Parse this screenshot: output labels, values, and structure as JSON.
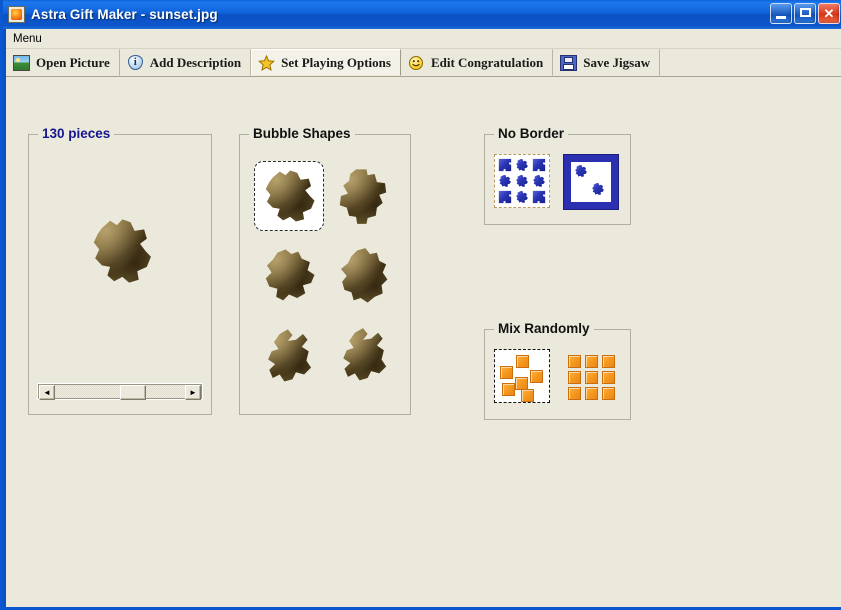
{
  "window": {
    "title_app": "Astra Gift Maker",
    "title_sep": " - ",
    "title_file": "sunset.jpg",
    "app_icon": "astra-app-icon",
    "controls": {
      "minimize": "minimize-button",
      "maximize": "maximize-button",
      "close": "close-button"
    },
    "colors": {
      "titlebar": "#0a51c4",
      "client_bg": "#ebe9dc",
      "legend_blue": "#16178c",
      "accent_orange": "#f79a1e",
      "accent_blue": "#2a30b0"
    }
  },
  "menubar": {
    "items": [
      {
        "label": "Menu"
      }
    ]
  },
  "toolbar": {
    "buttons": [
      {
        "label": "Open Picture",
        "icon": "picture-icon",
        "active": false
      },
      {
        "label": "Add Description",
        "icon": "info-icon",
        "active": false
      },
      {
        "label": "Set Playing Options",
        "icon": "star-icon",
        "active": true
      },
      {
        "label": "Edit Congratulation",
        "icon": "smiley-icon",
        "active": false
      },
      {
        "label": "Save Jigsaw",
        "icon": "floppy-icon",
        "active": false
      }
    ]
  },
  "panels": {
    "pieces": {
      "legend": "130 pieces",
      "piece_count": 130,
      "scrollbar": {
        "left_arrow": "◄",
        "right_arrow": "►",
        "thumb_position_pct": 50
      }
    },
    "shapes": {
      "legend": "Bubble Shapes",
      "items": [
        {
          "name": "shape-1",
          "selected": true
        },
        {
          "name": "shape-2",
          "selected": false
        },
        {
          "name": "shape-3",
          "selected": false
        },
        {
          "name": "shape-4",
          "selected": false
        },
        {
          "name": "shape-5",
          "selected": false
        },
        {
          "name": "shape-6",
          "selected": false
        }
      ]
    },
    "border": {
      "legend": "No Border",
      "options": [
        {
          "name": "no-border",
          "selected": true
        },
        {
          "name": "with-border",
          "selected": false
        }
      ]
    },
    "mix": {
      "legend": "Mix Randomly",
      "options": [
        {
          "name": "mix-random",
          "selected": true
        },
        {
          "name": "mix-aligned",
          "selected": false
        }
      ]
    }
  }
}
